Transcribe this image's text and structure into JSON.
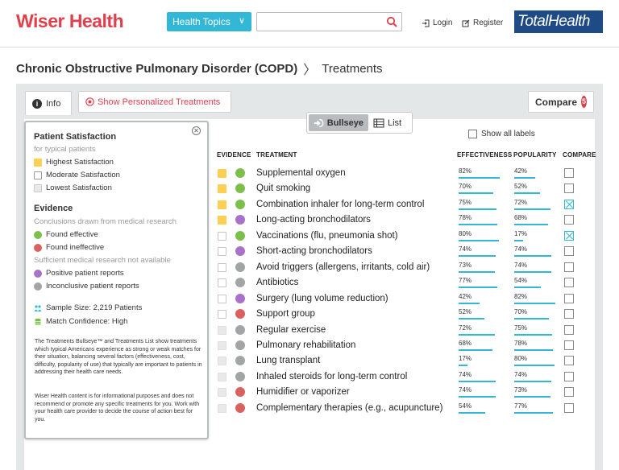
{
  "header": {
    "logo": "Wiser Health",
    "topics_label": "Health Topics",
    "search_placeholder": "",
    "login": "Login",
    "register": "Register",
    "partner_logo": "TotalHealth"
  },
  "breadcrumb": {
    "condition": "Chronic Obstructive Pulmonary Disorder (COPD)",
    "page": "Treatments"
  },
  "toolbar": {
    "info_label": "Info",
    "personalized_label": "Show Personalized Treatments",
    "compare_label": "Compare",
    "compare_count": "5",
    "bullseye_label": "Bullseye",
    "list_label": "List",
    "show_all_labels": "Show all labels"
  },
  "columns": {
    "evidence": "EVIDENCE",
    "treatment": "TREATMENT",
    "effectiveness": "EFFECTIVENESS",
    "popularity": "POPULARITY",
    "compare": "COMPARE"
  },
  "colors": {
    "highest": "#fdd054",
    "moderate": "#ffffff",
    "lowest": "#e9e9e9",
    "effective": "#7cc04b",
    "ineffective": "#d9615f",
    "positive_reports": "#a972c9",
    "inconclusive": "#a1a5a6",
    "accent": "#33b7d6",
    "brand": "#e0404b"
  },
  "treatments": [
    {
      "name": "Supplemental oxygen",
      "satisfaction": "highest",
      "evidence": "effective",
      "effectiveness": 82,
      "popularity": 42,
      "compare": false
    },
    {
      "name": "Quit smoking",
      "satisfaction": "highest",
      "evidence": "effective",
      "effectiveness": 70,
      "popularity": 52,
      "compare": false
    },
    {
      "name": "Combination inhaler for long-term control",
      "satisfaction": "highest",
      "evidence": "effective",
      "effectiveness": 75,
      "popularity": 72,
      "compare": true
    },
    {
      "name": "Long-acting bronchodilators",
      "satisfaction": "highest",
      "evidence": "positive_reports",
      "effectiveness": 78,
      "popularity": 68,
      "compare": false
    },
    {
      "name": "Vaccinations (flu, pneumonia shot)",
      "satisfaction": "moderate",
      "evidence": "effective",
      "effectiveness": 80,
      "popularity": 17,
      "compare": true
    },
    {
      "name": "Short-acting bronchodilators",
      "satisfaction": "moderate",
      "evidence": "positive_reports",
      "effectiveness": 74,
      "popularity": 74,
      "compare": false
    },
    {
      "name": "Avoid triggers (allergens, irritants, cold air)",
      "satisfaction": "moderate",
      "evidence": "inconclusive",
      "effectiveness": 73,
      "popularity": 74,
      "compare": false
    },
    {
      "name": "Antibiotics",
      "satisfaction": "moderate",
      "evidence": "inconclusive",
      "effectiveness": 77,
      "popularity": 54,
      "compare": false
    },
    {
      "name": "Surgery (lung volume reduction)",
      "satisfaction": "moderate",
      "evidence": "positive_reports",
      "effectiveness": 42,
      "popularity": 82,
      "compare": false
    },
    {
      "name": "Support group",
      "satisfaction": "moderate",
      "evidence": "ineffective",
      "effectiveness": 52,
      "popularity": 70,
      "compare": false
    },
    {
      "name": "Regular exercise",
      "satisfaction": "lowest",
      "evidence": "inconclusive",
      "effectiveness": 72,
      "popularity": 75,
      "compare": false
    },
    {
      "name": "Pulmonary rehabilitation",
      "satisfaction": "lowest",
      "evidence": "inconclusive",
      "effectiveness": 68,
      "popularity": 78,
      "compare": false
    },
    {
      "name": "Lung transplant",
      "satisfaction": "lowest",
      "evidence": "inconclusive",
      "effectiveness": 17,
      "popularity": 80,
      "compare": false
    },
    {
      "name": "Inhaled steroids for long-term control",
      "satisfaction": "lowest",
      "evidence": "inconclusive",
      "effectiveness": 74,
      "popularity": 74,
      "compare": false
    },
    {
      "name": "Humidifier or vaporizer",
      "satisfaction": "lowest",
      "evidence": "ineffective",
      "effectiveness": 74,
      "popularity": 73,
      "compare": false
    },
    {
      "name": "Complementary therapies (e.g., acupuncture)",
      "satisfaction": "lowest",
      "evidence": "ineffective",
      "effectiveness": 54,
      "popularity": 77,
      "compare": false
    }
  ],
  "info_popup": {
    "satisfaction_title": "Patient Satisfaction",
    "satisfaction_sub": "for typical patients",
    "highest": "Highest Satisfaction",
    "moderate": "Moderate Satisfaction",
    "lowest": "Lowest Satisfaction",
    "evidence_title": "Evidence",
    "evidence_sub": "Conclusions drawn from medical research",
    "found_effective": "Found effective",
    "found_ineffective": "Found ineffective",
    "insufficient": "Sufficient medical research not available",
    "positive_reports": "Positive patient reports",
    "inconclusive_reports": "Inconclusive patient reports",
    "sample_size": "Sample Size:  2,219 Patients",
    "match_confidence": "Match Confidence: High",
    "description": "The Treatments Bullseye™ and Treatments List show treatments which typical Americans experience as strong or weak matches for their situation, balancing several factors (effectiveness, cost, difficulty, popularity of use) that typically are important to patients in addressing their health care needs.",
    "disclaimer": "Wiser Health content is for informational purposes and does not recommend or promote any specific treatments for you. Work with your health care provider to decide the course of action best for you."
  }
}
